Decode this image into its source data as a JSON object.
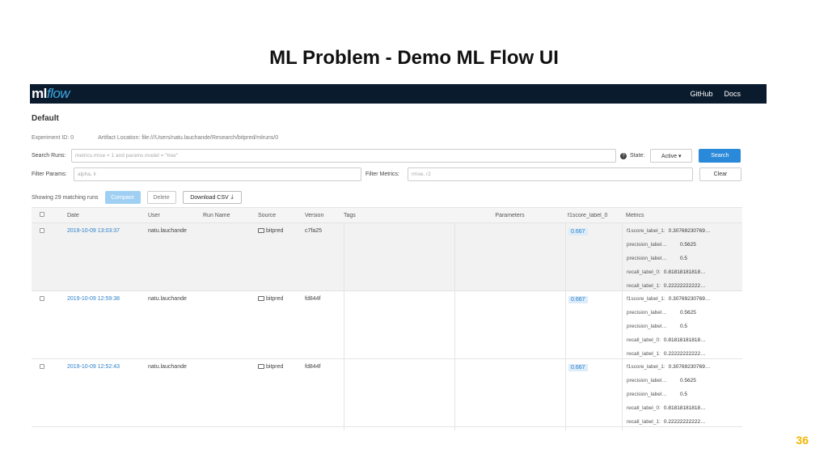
{
  "slide": {
    "title": "ML Problem  - Demo ML Flow UI",
    "page_number": "36"
  },
  "navbar": {
    "logo_ml": "ml",
    "logo_flow": "flow",
    "links": [
      "GitHub",
      "Docs"
    ]
  },
  "experiment": {
    "name": "Default",
    "id_text": "Experiment ID: 0",
    "artifact_text": "Artifact Location: file:///Users/natu.lauchande/Research/bitpred/mlruns/0"
  },
  "search": {
    "label": "Search Runs:",
    "placeholder": "metrics.rmse < 1 and params.model = \"tree\"",
    "state_label": "State:",
    "state_value": "Active ▾",
    "search_button": "Search"
  },
  "filters": {
    "params_label": "Filter Params:",
    "params_placeholder": "alpha, lr",
    "metrics_label": "Filter Metrics:",
    "metrics_placeholder": "rmse, r2",
    "clear_button": "Clear"
  },
  "actions": {
    "count_text": "Showing 29 matching runs",
    "compare": "Compare",
    "delete": "Delete",
    "download_csv": "Download CSV"
  },
  "table": {
    "headers": {
      "date": "Date",
      "user": "User",
      "run_name": "Run Name",
      "source": "Source",
      "version": "Version",
      "tags": "Tags",
      "parameters": "Parameters",
      "f1": "f1score_label_0",
      "metrics": "Metrics"
    },
    "rows": [
      {
        "date": "2019-10-09 13:03:37",
        "user": "natu.lauchande",
        "source": "bitpred",
        "version": "c7fa25",
        "f1": "0.667",
        "metrics": [
          {
            "k": "f1score_label_1:",
            "v": "0.30769230769…"
          },
          {
            "k": "precision_label…",
            "v": "0.5625"
          },
          {
            "k": "precision_label…",
            "v": "0.5"
          },
          {
            "k": "recall_label_0:",
            "v": "0.81818181818…"
          },
          {
            "k": "recall_label_1:",
            "v": "0.22222222222…"
          }
        ]
      },
      {
        "date": "2019-10-09 12:59:38",
        "user": "natu.lauchande",
        "source": "bitpred",
        "version": "fd844f",
        "f1": "0.667",
        "metrics": [
          {
            "k": "f1score_label_1:",
            "v": "0.30769230769…"
          },
          {
            "k": "precision_label…",
            "v": "0.5625"
          },
          {
            "k": "precision_label…",
            "v": "0.5"
          },
          {
            "k": "recall_label_0:",
            "v": "0.81818181818…"
          },
          {
            "k": "recall_label_1:",
            "v": "0.22222222222…"
          }
        ]
      },
      {
        "date": "2019-10-09 12:52:43",
        "user": "natu.lauchande",
        "source": "bitpred",
        "version": "fd844f",
        "f1": "0.667",
        "metrics": [
          {
            "k": "f1score_label_1:",
            "v": "0.30769230769…"
          },
          {
            "k": "precision_label…",
            "v": "0.5625"
          },
          {
            "k": "precision_label…",
            "v": "0.5"
          },
          {
            "k": "recall_label_0:",
            "v": "0.81818181818…"
          },
          {
            "k": "recall_label_1:",
            "v": "0.22222222222…"
          }
        ]
      }
    ]
  }
}
